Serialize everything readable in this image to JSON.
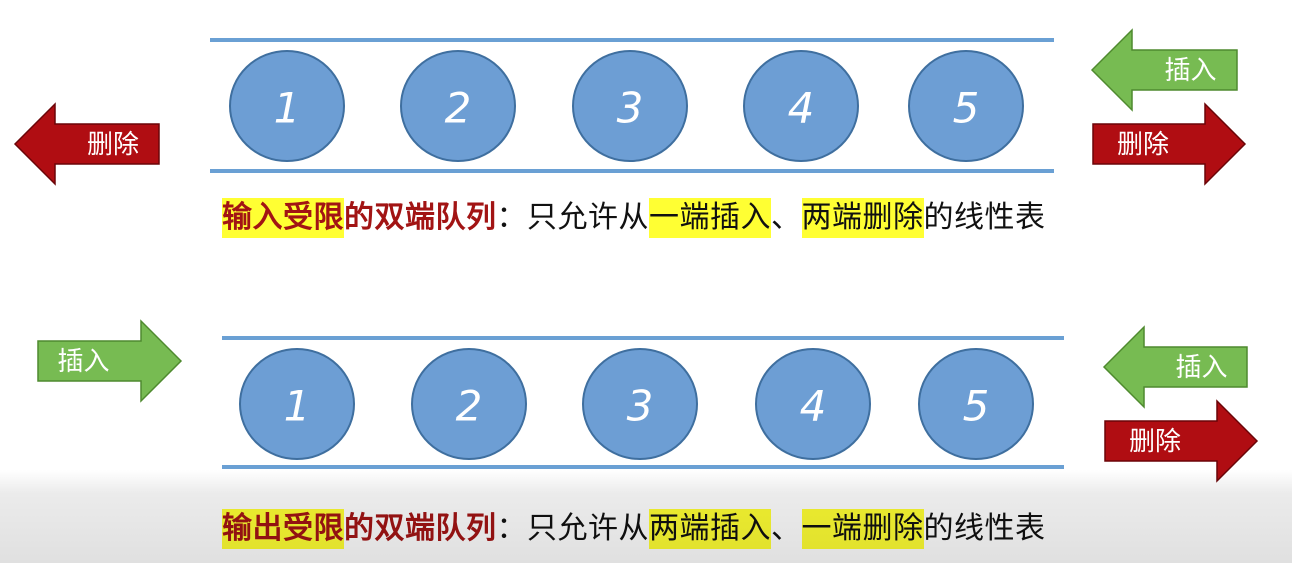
{
  "colors": {
    "rail": "#6aa0d4",
    "ball_fill": "#6d9ed4",
    "ball_stroke": "#3f6f9f",
    "insert_arrow": "#77bb52",
    "insert_stroke": "#4f8a2f",
    "delete_arrow": "#b00d12",
    "delete_stroke": "#6b0508",
    "highlight": "#ffff33",
    "term_text": "#a21414"
  },
  "labels": {
    "insert": "插入",
    "delete": "删除"
  },
  "queues": [
    {
      "id": "input-restricted",
      "elements": [
        "1",
        "2",
        "3",
        "4",
        "5"
      ],
      "left_arrows": [
        {
          "kind": "delete",
          "direction": "left"
        }
      ],
      "right_arrows": [
        {
          "kind": "insert",
          "direction": "left"
        },
        {
          "kind": "delete",
          "direction": "right"
        }
      ],
      "caption": {
        "term_hl": "输入受限",
        "term_rest": "的双端队列",
        "colon": "：",
        "pre": "只允许从",
        "hl1": "一端插入",
        "sep": "、",
        "hl2": "两端删除",
        "post": "的线性表"
      }
    },
    {
      "id": "output-restricted",
      "elements": [
        "1",
        "2",
        "3",
        "4",
        "5"
      ],
      "left_arrows": [
        {
          "kind": "insert",
          "direction": "right"
        }
      ],
      "right_arrows": [
        {
          "kind": "insert",
          "direction": "left"
        },
        {
          "kind": "delete",
          "direction": "right"
        }
      ],
      "caption": {
        "term_hl": "输出受限",
        "term_rest": "的双端队列",
        "colon": "：",
        "pre": "只允许从",
        "hl1": "两端插入",
        "sep": "、",
        "hl2": "一端删除",
        "post": "的线性表"
      }
    }
  ]
}
